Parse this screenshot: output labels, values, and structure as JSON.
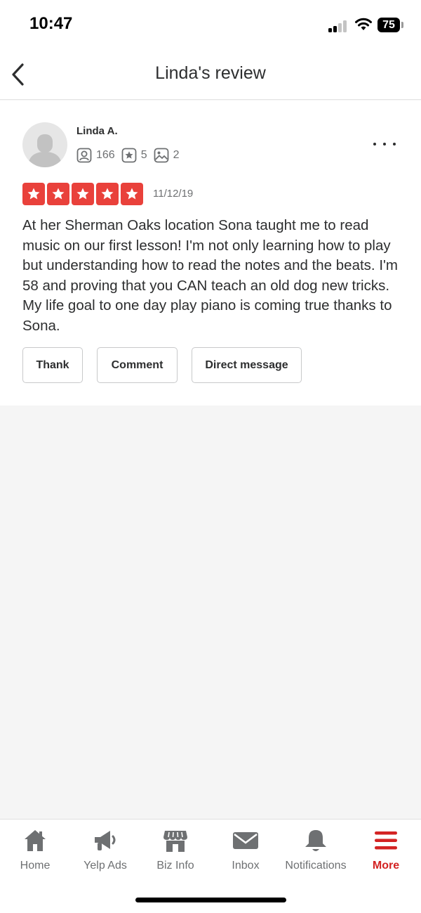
{
  "status_bar": {
    "time": "10:47",
    "battery": "75"
  },
  "header": {
    "title": "Linda's review"
  },
  "review": {
    "reviewer_name": "Linda A.",
    "stats": {
      "friends": "166",
      "reviews": "5",
      "photos": "2"
    },
    "rating": 5,
    "date": "11/12/19",
    "text": "At her Sherman Oaks location Sona taught me to read music on our first lesson! I'm not only learning how to play but understanding how to read the notes and the beats. I'm 58 and proving that you CAN teach an old dog new tricks. My life goal to one day play piano is coming true thanks to Sona.",
    "actions": {
      "thank": "Thank",
      "comment": "Comment",
      "direct_message": "Direct message"
    }
  },
  "tabs": [
    {
      "label": "Home",
      "icon": "home-icon"
    },
    {
      "label": "Yelp Ads",
      "icon": "megaphone-icon"
    },
    {
      "label": "Biz Info",
      "icon": "storefront-icon"
    },
    {
      "label": "Inbox",
      "icon": "envelope-icon"
    },
    {
      "label": "Notifications",
      "icon": "bell-icon"
    },
    {
      "label": "More",
      "icon": "menu-icon",
      "active": true
    }
  ],
  "colors": {
    "accent": "#d32323",
    "star": "#e9413b",
    "text": "#2d2e2f",
    "muted": "#6e7072"
  }
}
